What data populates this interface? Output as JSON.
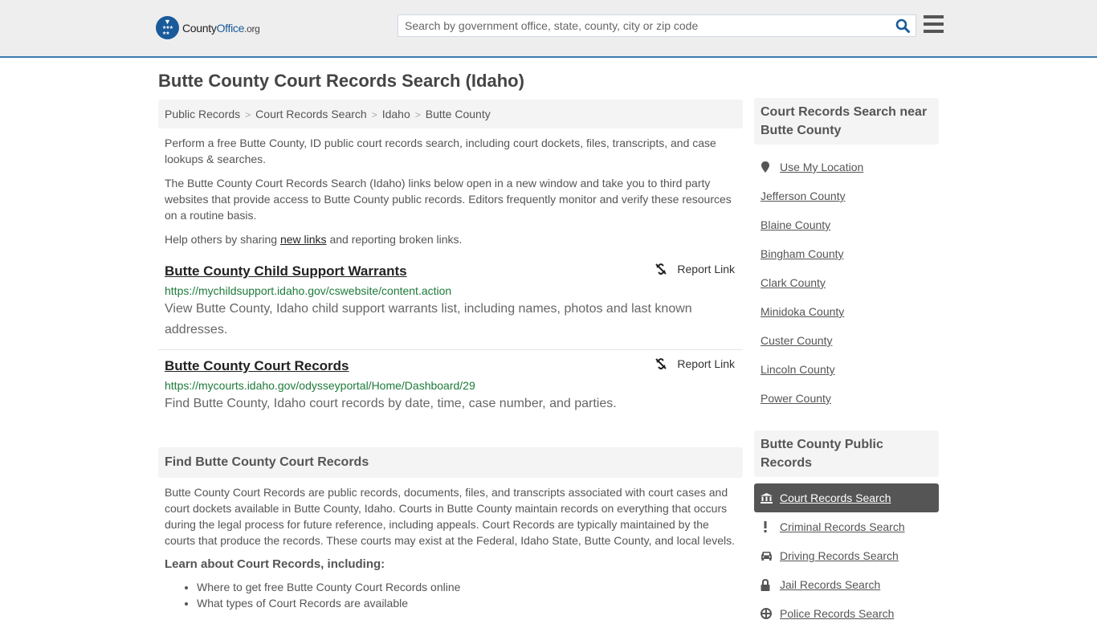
{
  "header": {
    "logo": {
      "county": "County",
      "office": "Office",
      "org": ".org"
    },
    "search_placeholder": "Search by government office, state, county, city or zip code",
    "search_icon": "search-icon",
    "menu_icon": "hamburger-menu-icon"
  },
  "page_title": "Butte County Court Records Search (Idaho)",
  "breadcrumb": [
    "Public Records",
    "Court Records Search",
    "Idaho",
    "Butte County"
  ],
  "intro": {
    "p1": "Perform a free Butte County, ID public court records search, including court dockets, files, transcripts, and case lookups & searches.",
    "p2": "The Butte County Court Records Search (Idaho) links below open in a new window and take you to third party websites that provide access to Butte County public records. Editors frequently monitor and verify these resources on a routine basis.",
    "p3_before": "Help others by sharing ",
    "p3_link": "new links",
    "p3_after": " and reporting broken links."
  },
  "results": [
    {
      "title": "Butte County Child Support Warrants",
      "url": "https://mychildsupport.idaho.gov/cswebsite/content.action",
      "description": "View Butte County, Idaho child support warrants list, including names, photos and last known addresses.",
      "report_label": "Report Link"
    },
    {
      "title": "Butte County Court Records",
      "url": "https://mycourts.idaho.gov/odysseyportal/Home/Dashboard/29",
      "description": "Find Butte County, Idaho court records by date, time, case number, and parties.",
      "report_label": "Report Link"
    }
  ],
  "find_section": {
    "heading": "Find Butte County Court Records",
    "body": "Butte County Court Records are public records, documents, files, and transcripts associated with court cases and court dockets available in Butte County, Idaho. Courts in Butte County maintain records on everything that occurs during the legal process for future reference, including appeals. Court Records are typically maintained by the courts that produce the records. These courts may exist at the Federal, Idaho State, Butte County, and local levels.",
    "subheading": "Learn about Court Records, including:",
    "bullets": [
      "Where to get free Butte County Court Records online",
      "What types of Court Records are available"
    ]
  },
  "sidebar": {
    "nearby_heading": "Court Records Search near Butte County",
    "use_location": "Use My Location",
    "nearby": [
      "Jefferson County",
      "Blaine County",
      "Bingham County",
      "Clark County",
      "Minidoka County",
      "Custer County",
      "Lincoln County",
      "Power County"
    ],
    "public_heading": "Butte County Public Records",
    "public_links": [
      {
        "label": "Court Records Search",
        "icon": "courthouse-icon",
        "active": true
      },
      {
        "label": "Criminal Records Search",
        "icon": "exclamation-icon",
        "active": false
      },
      {
        "label": "Driving Records Search",
        "icon": "car-icon",
        "active": false
      },
      {
        "label": "Jail Records Search",
        "icon": "lock-icon",
        "active": false
      },
      {
        "label": "Police Records Search",
        "icon": "police-badge-icon",
        "active": false
      }
    ]
  },
  "colors": {
    "accent": "#3a7cb0",
    "logo_blue": "#1a5a9a",
    "url_green": "#1e7a3a",
    "active_bg": "#555555"
  }
}
